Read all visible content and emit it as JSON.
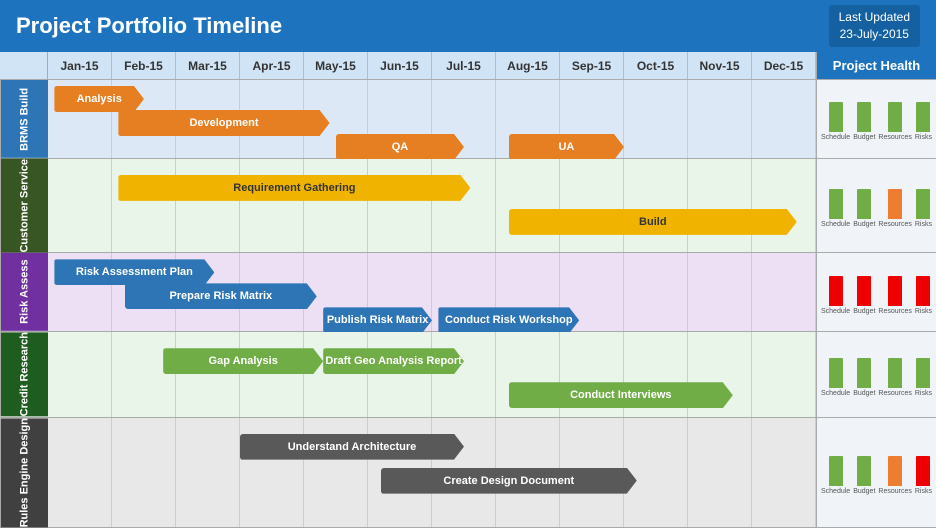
{
  "header": {
    "title": "Project Portfolio Timeline",
    "last_updated_label": "Last Updated",
    "last_updated_date": "23-July-2015"
  },
  "months": [
    "Jan-15",
    "Feb-15",
    "Mar-15",
    "Apr-15",
    "May-15",
    "Jun-15",
    "Jul-15",
    "Aug-15",
    "Sep-15",
    "Oct-15",
    "Nov-15",
    "Dec-15"
  ],
  "project_health_label": "Project Health",
  "rows": [
    {
      "id": "brms",
      "label": "BRMS Build",
      "label_color": "row-brms",
      "gantt_bg": "",
      "bars": [
        {
          "label": "Analysis",
          "color": "bar-orange",
          "start": 0.1,
          "width": 1.4
        },
        {
          "label": "Development",
          "color": "bar-orange",
          "start": 1.1,
          "width": 3.3
        },
        {
          "label": "QA",
          "color": "bar-orange",
          "start": 4.5,
          "width": 2.0
        },
        {
          "label": "UA",
          "color": "bar-orange",
          "start": 7.2,
          "width": 1.8
        }
      ],
      "health": [
        {
          "label": "Schedule",
          "height": 30,
          "color": "hb-green"
        },
        {
          "label": "Budget",
          "height": 30,
          "color": "hb-green"
        },
        {
          "label": "Resources",
          "height": 30,
          "color": "hb-green"
        },
        {
          "label": "Risks",
          "height": 30,
          "color": "hb-green"
        }
      ]
    },
    {
      "id": "customer",
      "label": "Customer Service",
      "label_color": "row-customer",
      "bars": [
        {
          "label": "Requirement Gathering",
          "color": "bar-yellow",
          "start": 1.1,
          "width": 5.5
        },
        {
          "label": "Build",
          "color": "bar-yellow",
          "start": 7.2,
          "width": 4.5
        }
      ],
      "health": [
        {
          "label": "Schedule",
          "height": 30,
          "color": "hb-green"
        },
        {
          "label": "Budget",
          "height": 30,
          "color": "hb-green"
        },
        {
          "label": "Resources",
          "height": 30,
          "color": "hb-orange"
        },
        {
          "label": "Risks",
          "height": 30,
          "color": "hb-green"
        }
      ]
    },
    {
      "id": "risk",
      "label": "Risk Assess",
      "label_color": "row-risk",
      "bars": [
        {
          "label": "Risk Assessment Plan",
          "color": "bar-blue",
          "start": 0.1,
          "width": 2.5
        },
        {
          "label": "Prepare Risk Matrix",
          "color": "bar-blue",
          "start": 1.2,
          "width": 3.0
        },
        {
          "label": "Publish Risk Matrix",
          "color": "bar-blue",
          "start": 4.3,
          "width": 1.7
        },
        {
          "label": "Conduct Risk Workshop",
          "color": "bar-blue",
          "start": 6.1,
          "width": 2.2
        }
      ],
      "health": [
        {
          "label": "Schedule",
          "height": 30,
          "color": "hb-red"
        },
        {
          "label": "Budget",
          "height": 30,
          "color": "hb-red"
        },
        {
          "label": "Resources",
          "height": 30,
          "color": "hb-red"
        },
        {
          "label": "Risks",
          "height": 30,
          "color": "hb-red"
        }
      ]
    },
    {
      "id": "credit",
      "label": "Credit Research",
      "label_color": "row-credit",
      "bars": [
        {
          "label": "Gap Analysis",
          "color": "bar-green",
          "start": 1.8,
          "width": 2.5
        },
        {
          "label": "Draft Geo Analysis Report",
          "color": "bar-green",
          "start": 4.3,
          "width": 2.2
        },
        {
          "label": "Conduct Interviews",
          "color": "bar-green",
          "start": 7.2,
          "width": 3.5
        }
      ],
      "health": [
        {
          "label": "Schedule",
          "height": 30,
          "color": "hb-green"
        },
        {
          "label": "Budget",
          "height": 30,
          "color": "hb-green"
        },
        {
          "label": "Resources",
          "height": 30,
          "color": "hb-green"
        },
        {
          "label": "Risks",
          "height": 30,
          "color": "hb-green"
        }
      ]
    },
    {
      "id": "rules",
      "label": "Rules Engine Design",
      "label_color": "row-rules",
      "bars": [
        {
          "label": "Understand Architecture",
          "color": "bar-dark-gray",
          "start": 3.0,
          "width": 3.5
        },
        {
          "label": "Create Design Document",
          "color": "bar-dark-gray",
          "start": 5.2,
          "width": 4.0
        }
      ],
      "health": [
        {
          "label": "Schedule",
          "height": 30,
          "color": "hb-green"
        },
        {
          "label": "Budget",
          "height": 30,
          "color": "hb-green"
        },
        {
          "label": "Resources",
          "height": 30,
          "color": "hb-orange"
        },
        {
          "label": "Risks",
          "height": 30,
          "color": "hb-red"
        }
      ]
    }
  ]
}
